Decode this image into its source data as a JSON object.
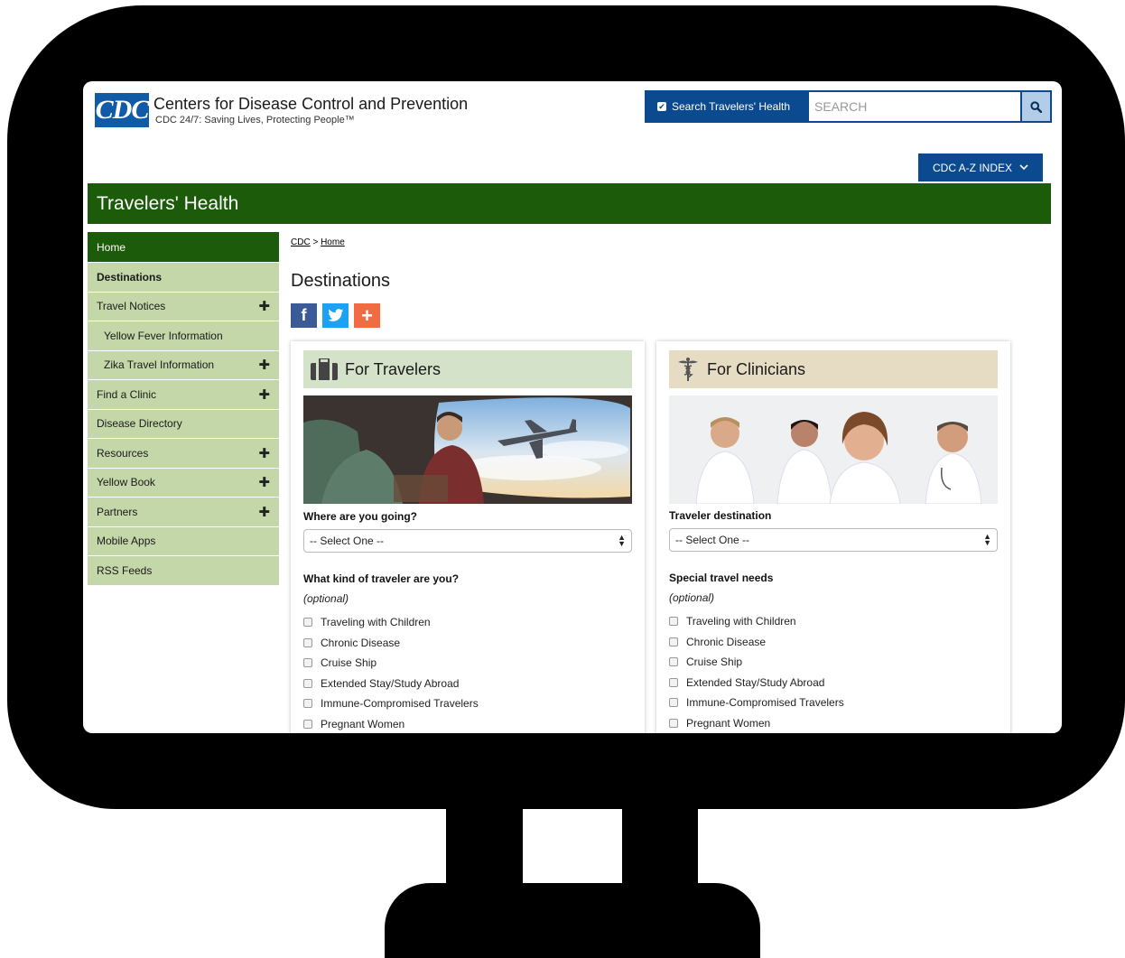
{
  "header": {
    "logo_text": "CDC",
    "org_name": "Centers for Disease Control and Prevention",
    "tagline": "CDC 24/7: Saving Lives, Protecting People™",
    "search_scope_label": "Search Travelers' Health",
    "search_placeholder": "SEARCH",
    "az_index_label": "CDC A-Z INDEX"
  },
  "banner": {
    "title": "Travelers' Health"
  },
  "sidebar": {
    "items": [
      {
        "label": "Home",
        "expandable": false
      },
      {
        "label": "Destinations",
        "expandable": false
      },
      {
        "label": "Travel Notices",
        "expandable": true
      },
      {
        "label": "Yellow Fever Information",
        "expandable": false
      },
      {
        "label": "Zika Travel Information",
        "expandable": true
      },
      {
        "label": "Find a Clinic",
        "expandable": true
      },
      {
        "label": "Disease Directory",
        "expandable": false
      },
      {
        "label": "Resources",
        "expandable": true
      },
      {
        "label": "Yellow Book",
        "expandable": true
      },
      {
        "label": "Partners",
        "expandable": true
      },
      {
        "label": "Mobile Apps",
        "expandable": false
      },
      {
        "label": "RSS Feeds",
        "expandable": false
      }
    ]
  },
  "breadcrumb": {
    "root": "CDC",
    "separator": ">",
    "current": "Home"
  },
  "main": {
    "title": "Destinations",
    "share": {
      "facebook": "f",
      "add": "+"
    }
  },
  "travelers_card": {
    "title": "For Travelers",
    "destination_label": "Where are you going?",
    "select_value": "-- Select One --",
    "traveler_type_label": "What kind of traveler are you?",
    "optional_label": "(optional)",
    "options": [
      "Traveling with Children",
      "Chronic Disease",
      "Cruise Ship",
      "Extended Stay/Study Abroad",
      "Immune-Compromised Travelers",
      "Pregnant Women"
    ]
  },
  "clinicians_card": {
    "title": "For Clinicians",
    "destination_label": "Traveler destination",
    "select_value": "-- Select One --",
    "needs_label": "Special travel needs",
    "optional_label": "(optional)",
    "options": [
      "Traveling with Children",
      "Chronic Disease",
      "Cruise Ship",
      "Extended Stay/Study Abroad",
      "Immune-Compromised Travelers",
      "Pregnant Women"
    ]
  },
  "colors": {
    "cdc_blue": "#0b4a8f",
    "banner_green": "#1c5b0a",
    "sidebar_green": "#c4d7a9",
    "travelers_header": "#d3e2c8",
    "clinicians_header": "#e6dcc3"
  }
}
